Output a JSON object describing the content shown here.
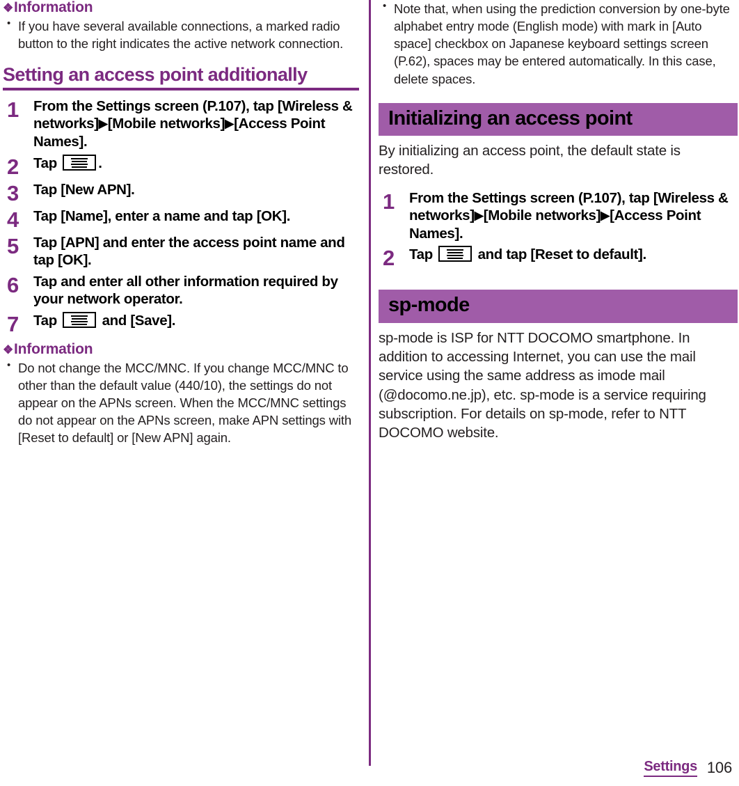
{
  "page": {
    "footer_section": "Settings",
    "footer_page_number": "106",
    "accent_deep_purple": "#7b2a80",
    "accent_banner_purple": "#a05ca8",
    "body_color": "#231f20"
  },
  "icons": {
    "diamond": "❖",
    "menu": "menu-icon",
    "arrow": "▶"
  },
  "left_column": {
    "info_top": {
      "heading": "Information",
      "bullets": [
        "If you have several available connections, a marked radio button to the right indicates the active network connection."
      ]
    },
    "section": {
      "heading": "Setting an access point additionally",
      "steps": [
        {
          "number": "1",
          "parts": [
            {
              "type": "text",
              "value": "From the Settings screen (P.107), tap [Wireless & networks]"
            },
            {
              "type": "arrow"
            },
            {
              "type": "text",
              "value": "[Mobile networks]"
            },
            {
              "type": "arrow"
            },
            {
              "type": "text",
              "value": "[Access Point Names]."
            }
          ]
        },
        {
          "number": "2",
          "parts": [
            {
              "type": "text",
              "value": "Tap "
            },
            {
              "type": "menu-icon"
            },
            {
              "type": "text",
              "value": "."
            }
          ]
        },
        {
          "number": "3",
          "parts": [
            {
              "type": "text",
              "value": "Tap [New APN]."
            }
          ]
        },
        {
          "number": "4",
          "parts": [
            {
              "type": "text",
              "value": "Tap [Name], enter a name and tap [OK]."
            }
          ]
        },
        {
          "number": "5",
          "parts": [
            {
              "type": "text",
              "value": "Tap [APN] and enter the access point name and tap [OK]."
            }
          ]
        },
        {
          "number": "6",
          "parts": [
            {
              "type": "text",
              "value": "Tap and enter all other information required by your network operator."
            }
          ]
        },
        {
          "number": "7",
          "parts": [
            {
              "type": "text",
              "value": "Tap "
            },
            {
              "type": "menu-icon"
            },
            {
              "type": "text",
              "value": " and [Save]."
            }
          ]
        }
      ]
    },
    "info_bottom": {
      "heading": "Information",
      "bullets": [
        "Do not change the MCC/MNC. If you change MCC/MNC to other than the default value (440/10), the settings do not appear on the APNs screen. When the MCC/MNC settings do not appear on the APNs screen, make APN settings with [Reset to default] or [New APN] again."
      ]
    }
  },
  "right_column": {
    "top_bullets": [
      "Note that, when using the prediction conversion by one-byte alphabet entry mode (English mode) with mark in [Auto space] checkbox on Japanese keyboard settings screen (P.62), spaces may be entered automatically. In this case, delete spaces."
    ],
    "section_initializing": {
      "banner": "Initializing an access point",
      "intro": "By initializing an access point, the default state is restored.",
      "steps": [
        {
          "number": "1",
          "parts": [
            {
              "type": "text",
              "value": "From the Settings screen (P.107), tap [Wireless & networks]"
            },
            {
              "type": "arrow"
            },
            {
              "type": "text",
              "value": "[Mobile networks]"
            },
            {
              "type": "arrow"
            },
            {
              "type": "text",
              "value": "[Access Point Names]."
            }
          ]
        },
        {
          "number": "2",
          "parts": [
            {
              "type": "text",
              "value": "Tap "
            },
            {
              "type": "menu-icon"
            },
            {
              "type": "text",
              "value": " and tap [Reset to default]."
            }
          ]
        }
      ]
    },
    "section_spmode": {
      "banner": "sp-mode",
      "body": "sp-mode is ISP for NTT DOCOMO smartphone. In addition to accessing Internet, you can use the mail service using the same address as imode mail (@docomo.ne.jp), etc. sp-mode is a service requiring subscription. For details on sp-mode, refer to NTT DOCOMO website."
    }
  }
}
